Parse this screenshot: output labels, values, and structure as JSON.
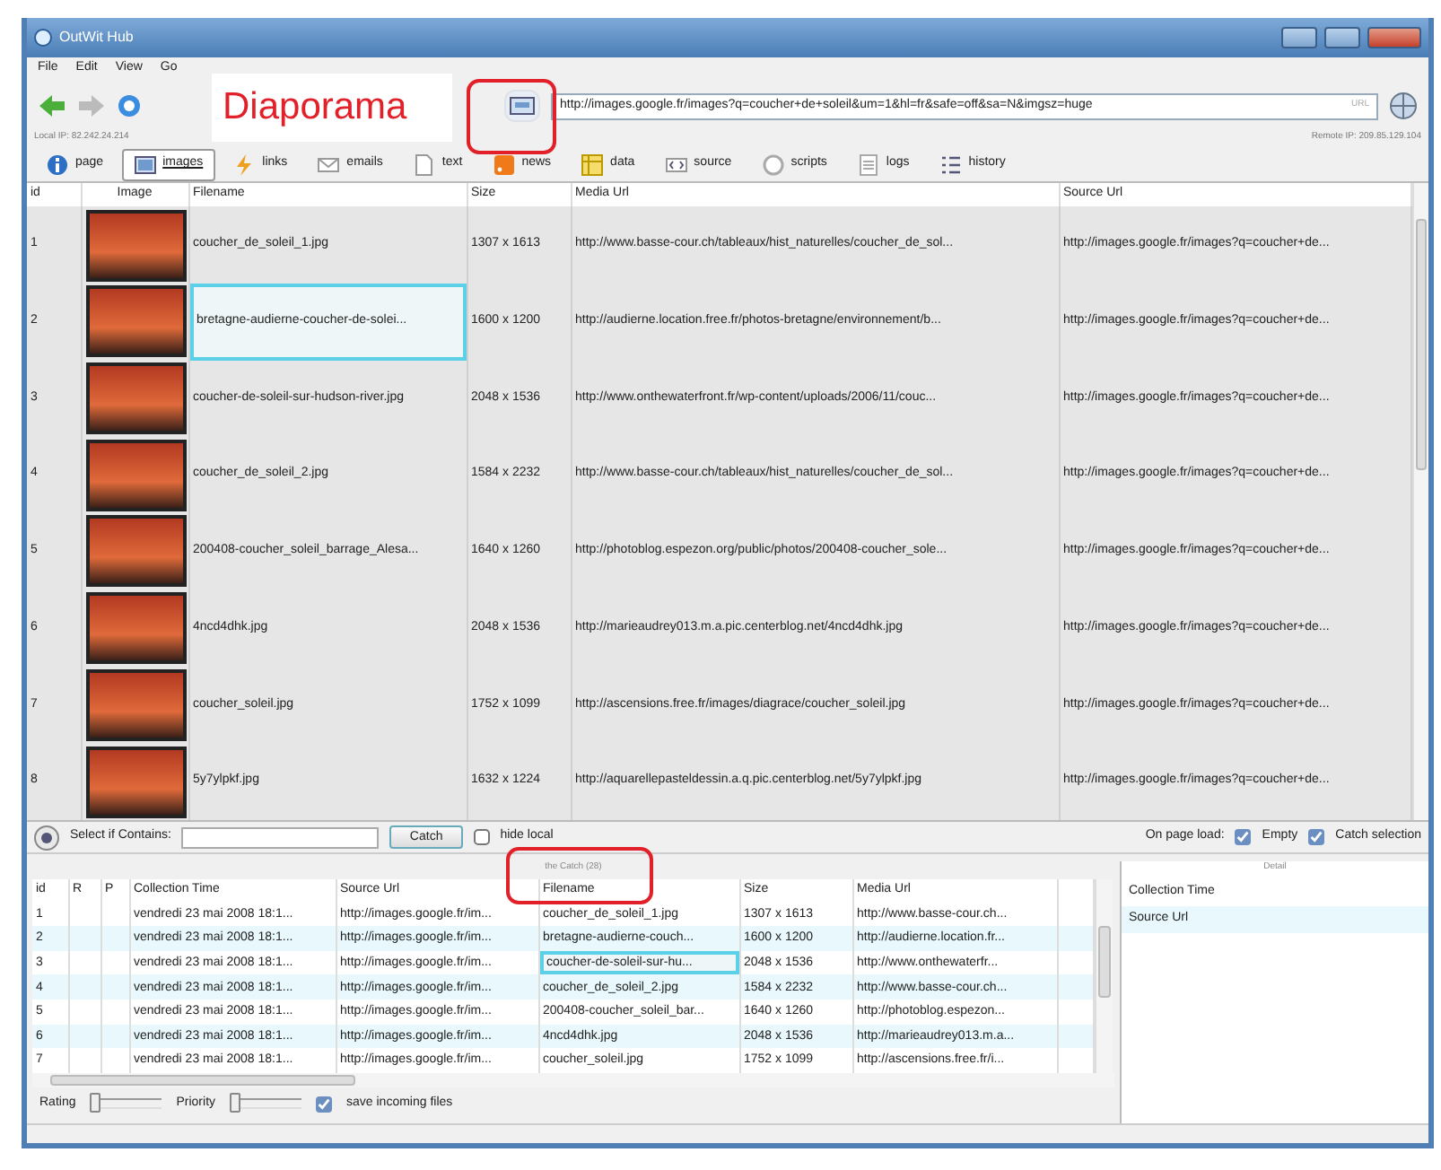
{
  "window": {
    "title": "OutWit Hub"
  },
  "menu": [
    "File",
    "Edit",
    "View",
    "Go"
  ],
  "annotation": {
    "label": "Diaporama"
  },
  "toolbar": {
    "slideshow_button_circled": true,
    "url": "http://images.google.fr/images?q=coucher+de+soleil&um=1&hl=fr&safe=off&sa=N&imgsz=huge",
    "url_badge": "URL"
  },
  "ip_row": {
    "local": "Local IP: 82.242.24.214",
    "remote": "Remote IP: 209.85.129.104"
  },
  "tabs": [
    {
      "label": "page",
      "selected": false
    },
    {
      "label": "images",
      "selected": true
    },
    {
      "label": "links",
      "selected": false
    },
    {
      "label": "emails",
      "selected": false
    },
    {
      "label": "text",
      "selected": false
    },
    {
      "label": "news",
      "selected": false
    },
    {
      "label": "data",
      "selected": false
    },
    {
      "label": "source",
      "selected": false
    },
    {
      "label": "scripts",
      "selected": false
    },
    {
      "label": "logs",
      "selected": false
    },
    {
      "label": "history",
      "selected": false
    }
  ],
  "table": {
    "columns": [
      "id",
      "Image",
      "Filename",
      "Size",
      "Media Url",
      "Source Url"
    ],
    "rows": [
      {
        "id": "1",
        "filename": "coucher_de_soleil_1.jpg",
        "size": "1307 x 1613",
        "media_url": "http://www.basse-cour.ch/tableaux/hist_naturelles/coucher_de_sol...",
        "source_url": "http://images.google.fr/images?q=coucher+de...",
        "selected": false
      },
      {
        "id": "2",
        "filename": "bretagne-audierne-coucher-de-solei...",
        "size": "1600 x 1200",
        "media_url": "http://audierne.location.free.fr/photos-bretagne/environnement/b...",
        "source_url": "http://images.google.fr/images?q=coucher+de...",
        "selected": true
      },
      {
        "id": "3",
        "filename": "coucher-de-soleil-sur-hudson-river.jpg",
        "size": "2048 x 1536",
        "media_url": "http://www.onthewaterfront.fr/wp-content/uploads/2006/11/couc...",
        "source_url": "http://images.google.fr/images?q=coucher+de...",
        "selected": false
      },
      {
        "id": "4",
        "filename": "coucher_de_soleil_2.jpg",
        "size": "1584 x 2232",
        "media_url": "http://www.basse-cour.ch/tableaux/hist_naturelles/coucher_de_sol...",
        "source_url": "http://images.google.fr/images?q=coucher+de...",
        "selected": false
      },
      {
        "id": "5",
        "filename": "200408-coucher_soleil_barrage_Alesa...",
        "size": "1640 x 1260",
        "media_url": "http://photoblog.espezon.org/public/photos/200408-coucher_sole...",
        "source_url": "http://images.google.fr/images?q=coucher+de...",
        "selected": false
      },
      {
        "id": "6",
        "filename": "4ncd4dhk.jpg",
        "size": "2048 x 1536",
        "media_url": "http://marieaudrey013.m.a.pic.centerblog.net/4ncd4dhk.jpg",
        "source_url": "http://images.google.fr/images?q=coucher+de...",
        "selected": false
      },
      {
        "id": "7",
        "filename": "coucher_soleil.jpg",
        "size": "1752 x 1099",
        "media_url": "http://ascensions.free.fr/images/diagrace/coucher_soleil.jpg",
        "source_url": "http://images.google.fr/images?q=coucher+de...",
        "selected": false
      },
      {
        "id": "8",
        "filename": "5y7ylpkf.jpg",
        "size": "1632 x 1224",
        "media_url": "http://aquarellepasteldessin.a.q.pic.centerblog.net/5y7ylpkf.jpg",
        "source_url": "http://images.google.fr/images?q=coucher+de...",
        "selected": false
      }
    ]
  },
  "filter_bar": {
    "label": "Select if Contains:",
    "catch_button": "Catch",
    "hide_local": {
      "label": "hide local",
      "checked": false
    },
    "on_page_load": "On page load:",
    "empty": {
      "label": "Empty",
      "checked": true
    },
    "catch_selection": {
      "label": "Catch selection",
      "checked": true
    }
  },
  "catch": {
    "title": "the Catch (28)",
    "title_circled": true,
    "columns": [
      "id",
      "R",
      "P",
      "Collection Time",
      "Source Url",
      "Filename",
      "Size",
      "Media Url"
    ],
    "rows": [
      {
        "id": "1",
        "time": "vendredi 23 mai 2008 18:1...",
        "source_url": "http://images.google.fr/im...",
        "filename": "coucher_de_soleil_1.jpg",
        "size": "1307 x 1613",
        "media_url": "http://www.basse-cour.ch...",
        "selected": false
      },
      {
        "id": "2",
        "time": "vendredi 23 mai 2008 18:1...",
        "source_url": "http://images.google.fr/im...",
        "filename": "bretagne-audierne-couch...",
        "size": "1600 x 1200",
        "media_url": "http://audierne.location.fr...",
        "selected": false
      },
      {
        "id": "3",
        "time": "vendredi 23 mai 2008 18:1...",
        "source_url": "http://images.google.fr/im...",
        "filename": "coucher-de-soleil-sur-hu...",
        "size": "2048 x 1536",
        "media_url": "http://www.onthewaterfr...",
        "selected": true
      },
      {
        "id": "4",
        "time": "vendredi 23 mai 2008 18:1...",
        "source_url": "http://images.google.fr/im...",
        "filename": "coucher_de_soleil_2.jpg",
        "size": "1584 x 2232",
        "media_url": "http://www.basse-cour.ch...",
        "selected": false
      },
      {
        "id": "5",
        "time": "vendredi 23 mai 2008 18:1...",
        "source_url": "http://images.google.fr/im...",
        "filename": "200408-coucher_soleil_bar...",
        "size": "1640 x 1260",
        "media_url": "http://photoblog.espezon...",
        "selected": false
      },
      {
        "id": "6",
        "time": "vendredi 23 mai 2008 18:1...",
        "source_url": "http://images.google.fr/im...",
        "filename": "4ncd4dhk.jpg",
        "size": "2048 x 1536",
        "media_url": "http://marieaudrey013.m.a...",
        "selected": false
      },
      {
        "id": "7",
        "time": "vendredi 23 mai 2008 18:1...",
        "source_url": "http://images.google.fr/im...",
        "filename": "coucher_soleil.jpg",
        "size": "1752 x 1099",
        "media_url": "http://ascensions.free.fr/i...",
        "selected": false
      }
    ]
  },
  "detail": {
    "title": "Detail",
    "rows": [
      {
        "label": "Collection Time",
        "selected": false
      },
      {
        "label": "Source Url",
        "selected": true
      }
    ]
  },
  "bottom": {
    "rating": {
      "label": "Rating",
      "level": 0
    },
    "priority": {
      "label": "Priority",
      "level": 0
    },
    "save_incoming": {
      "label": "save incoming files",
      "checked": true
    }
  }
}
